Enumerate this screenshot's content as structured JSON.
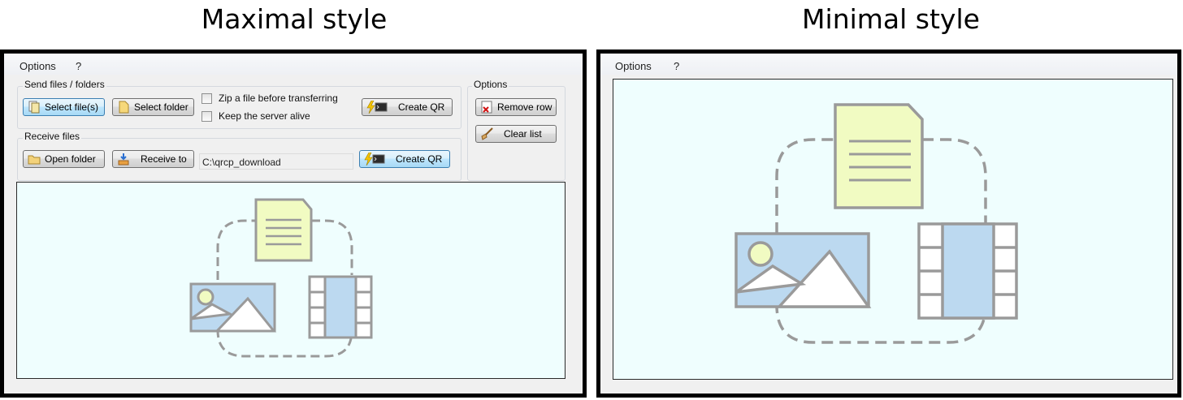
{
  "headings": {
    "left": "Maximal style",
    "right": "Minimal style"
  },
  "maximal": {
    "menu": {
      "options": "Options",
      "help": "?"
    },
    "send_group": {
      "title": "Send files / folders",
      "select_files": "Select file(s)",
      "select_folder": "Select folder",
      "zip_checkbox": "Zip a file before transferring",
      "keep_alive_checkbox": "Keep the server alive",
      "create_qr": "Create QR"
    },
    "receive_group": {
      "title": "Receive files",
      "open_folder": "Open folder",
      "receive_to": "Receive to",
      "path": "C:\\qrcp_download",
      "create_qr": "Create QR"
    },
    "options_group": {
      "title": "Options",
      "remove_row": "Remove row",
      "clear_list": "Clear list"
    }
  },
  "minimal": {
    "menu": {
      "options": "Options",
      "help": "?"
    }
  },
  "colors": {
    "dropzone_bg": "#effefe",
    "document": "#f1fbc2",
    "media": "#bcd9f0",
    "stroke": "#9a9a9a"
  }
}
